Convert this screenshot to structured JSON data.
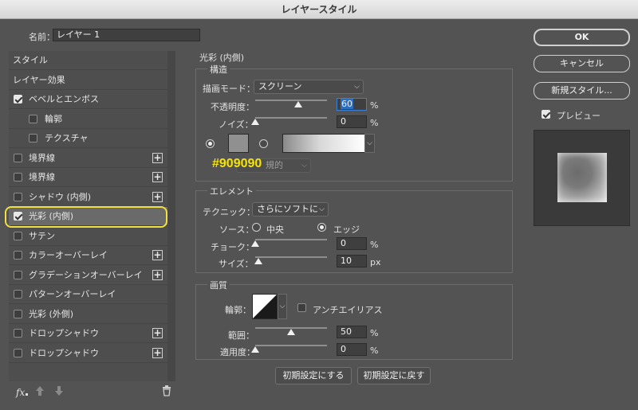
{
  "window": {
    "title": "レイヤースタイル"
  },
  "name_field": {
    "label": "名前：",
    "value": "レイヤー 1"
  },
  "left_list": {
    "items": [
      {
        "label": "スタイル",
        "checkbox": false,
        "checked": false,
        "plus": false,
        "indent": false
      },
      {
        "label": "レイヤー効果",
        "checkbox": false,
        "checked": false,
        "plus": false,
        "indent": false
      },
      {
        "label": "ベベルとエンボス",
        "checkbox": true,
        "checked": true,
        "plus": false,
        "indent": false
      },
      {
        "label": "輪郭",
        "checkbox": true,
        "checked": false,
        "plus": false,
        "indent": true
      },
      {
        "label": "テクスチャ",
        "checkbox": true,
        "checked": false,
        "plus": false,
        "indent": true
      },
      {
        "label": "境界線",
        "checkbox": true,
        "checked": false,
        "plus": true,
        "indent": false
      },
      {
        "label": "境界線",
        "checkbox": true,
        "checked": false,
        "plus": true,
        "indent": false
      },
      {
        "label": "シャドウ (内側)",
        "checkbox": true,
        "checked": false,
        "plus": true,
        "indent": false
      },
      {
        "label": "光彩 (内側)",
        "checkbox": true,
        "checked": true,
        "plus": false,
        "indent": false,
        "active": true
      },
      {
        "label": "サテン",
        "checkbox": true,
        "checked": false,
        "plus": false,
        "indent": false
      },
      {
        "label": "カラーオーバーレイ",
        "checkbox": true,
        "checked": false,
        "plus": true,
        "indent": false
      },
      {
        "label": "グラデーションオーバーレイ",
        "checkbox": true,
        "checked": false,
        "plus": true,
        "indent": false
      },
      {
        "label": "パターンオーバーレイ",
        "checkbox": true,
        "checked": false,
        "plus": false,
        "indent": false
      },
      {
        "label": "光彩 (外側)",
        "checkbox": true,
        "checked": false,
        "plus": false,
        "indent": false
      },
      {
        "label": "ドロップシャドウ",
        "checkbox": true,
        "checked": false,
        "plus": true,
        "indent": false
      },
      {
        "label": "ドロップシャドウ",
        "checkbox": true,
        "checked": false,
        "plus": true,
        "indent": false
      }
    ],
    "footer": {
      "fx_label": "fx"
    }
  },
  "panel": {
    "title": "光彩 (内側)",
    "structure": {
      "title": "構造",
      "blend_mode_label": "描画モード：",
      "blend_mode_value": "スクリーン",
      "opacity_label": "不透明度：",
      "opacity_value": "60",
      "opacity_unit": "%",
      "opacity_level": 60,
      "noise_label": "ノイズ：",
      "noise_value": "0",
      "noise_unit": "%",
      "noise_level": 0,
      "color_swatch": "#909090",
      "color_annotation": "#909090",
      "gradient_mode_label": "規的"
    },
    "elements": {
      "title": "エレメント",
      "technique_label": "テクニック：",
      "technique_value": "さらにソフトに",
      "source_label": "ソース：",
      "source_center": "中央",
      "source_edge": "エッジ",
      "choke_label": "チョーク：",
      "choke_value": "0",
      "choke_unit": "%",
      "choke_level": 0,
      "size_label": "サイズ：",
      "size_value": "10",
      "size_unit": "px",
      "size_level": 4
    },
    "quality": {
      "title": "画質",
      "contour_label": "輪郭：",
      "antialias_label": "アンチエイリアス",
      "range_label": "範囲：",
      "range_value": "50",
      "range_unit": "%",
      "range_level": 50,
      "jitter_label": "適用度：",
      "jitter_value": "0",
      "jitter_unit": "%",
      "jitter_level": 0
    },
    "buttons": {
      "make_default": "初期設定にする",
      "reset_default": "初期設定に戻す"
    }
  },
  "right": {
    "ok": "OK",
    "cancel": "キャンセル",
    "new_style": "新規スタイル...",
    "preview_label": "プレビュー"
  },
  "colors": {
    "highlight": "#f0e040",
    "annotation": "#f5e30a",
    "focus": "#2d6fbf"
  }
}
